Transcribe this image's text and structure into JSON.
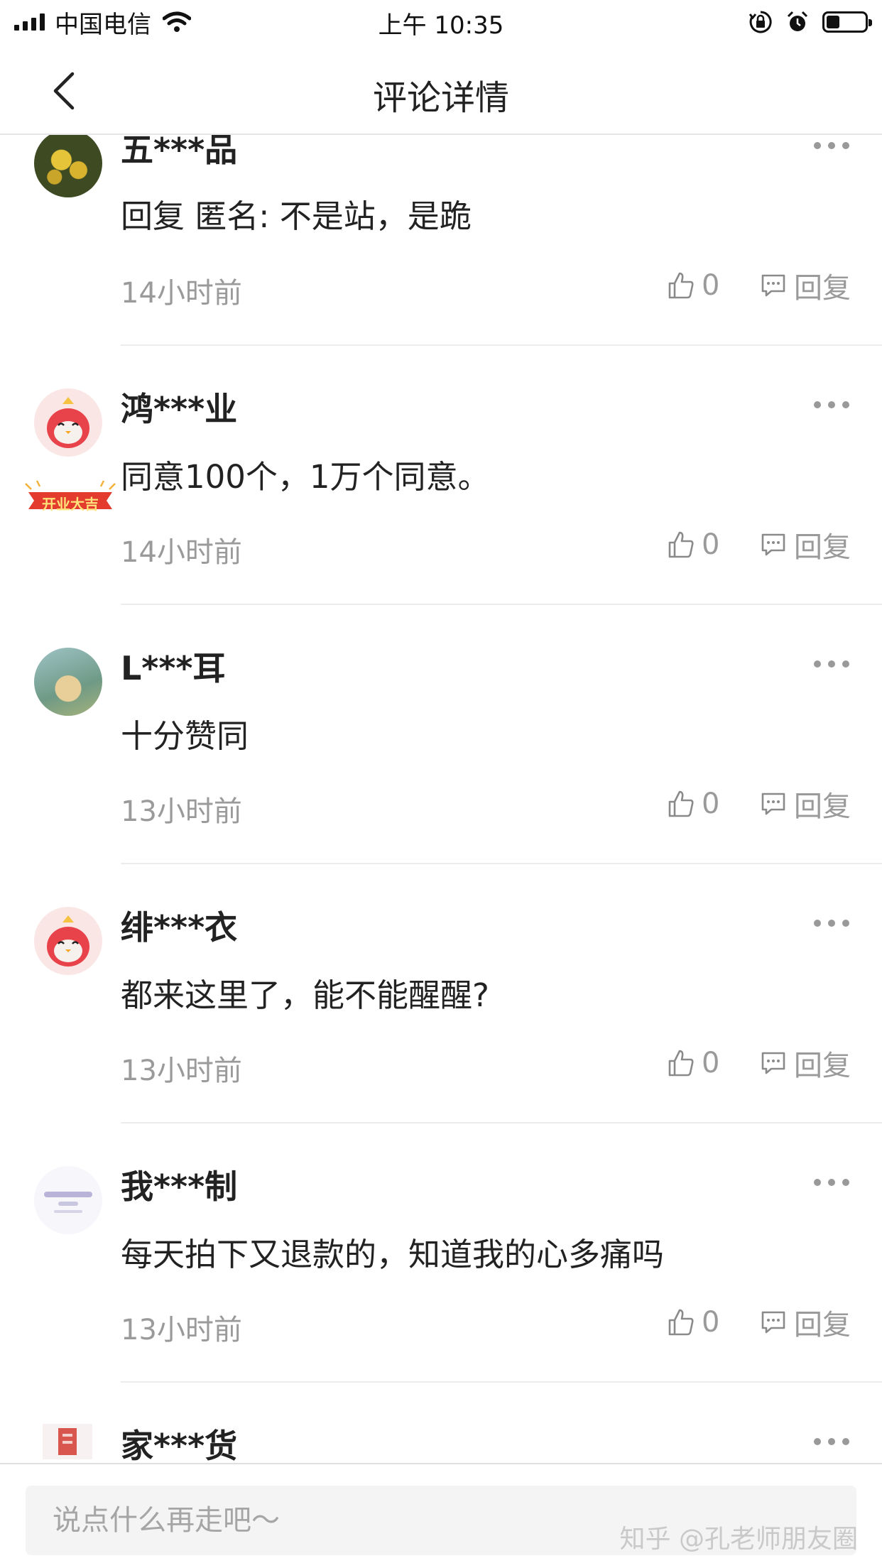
{
  "status_bar": {
    "carrier": "中国电信",
    "time": "上午 10:35",
    "battery_level": 0.35
  },
  "nav": {
    "title": "评论详情",
    "back_icon": "chevron-left-icon"
  },
  "comments": [
    {
      "user": "五***品",
      "text": "回复 匿名: 不是站，是跪",
      "time": "14小时前",
      "likes": "0",
      "reply_label": "回复"
    },
    {
      "user": "鸿***业",
      "text": "同意100个，1万个同意。",
      "time": "14小时前",
      "likes": "0",
      "reply_label": "回复"
    },
    {
      "user": "L***耳",
      "text": "十分赞同",
      "time": "13小时前",
      "likes": "0",
      "reply_label": "回复",
      "avatar_badge": "开业大吉"
    },
    {
      "user": "绯***衣",
      "text": "都来这里了，能不能醒醒?",
      "time": "13小时前",
      "likes": "0",
      "reply_label": "回复"
    },
    {
      "user": "我***制",
      "text": "每天拍下又退款的，知道我的心多痛吗",
      "time": "13小时前",
      "likes": "0",
      "reply_label": "回复"
    },
    {
      "user": "家***货"
    }
  ],
  "input": {
    "placeholder": "说点什么再走吧～"
  },
  "watermark": "知乎 @孔老师朋友圈",
  "colors": {
    "text": "#222222",
    "muted": "#9a9a9a",
    "divider": "#ececec",
    "mascot": "#e8424a"
  }
}
